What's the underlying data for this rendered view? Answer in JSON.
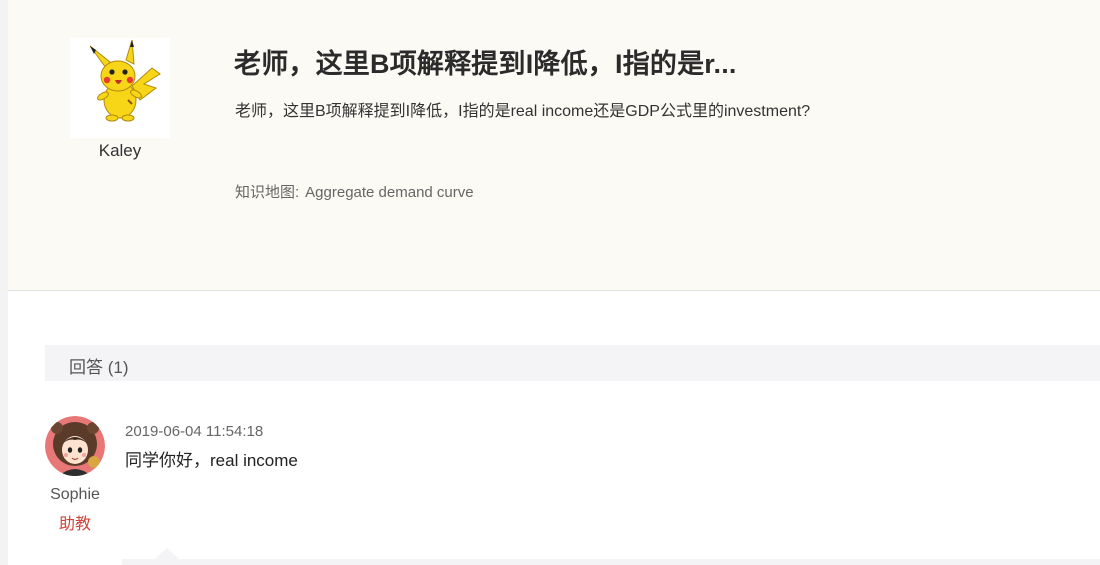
{
  "question": {
    "asker_name": "Kaley",
    "title": "老师，这里B项解释提到I降低，I指的是r...",
    "body": "老师，这里B项解释提到I降低，I指的是real income还是GDP公式里的investment?",
    "knowledge_map_label": "知识地图:",
    "knowledge_map_value": "Aggregate demand curve"
  },
  "answers": {
    "header": "回答 (1)",
    "items": [
      {
        "author_name": "Sophie",
        "author_role": "助教",
        "timestamp": "2019-06-04 11:54:18",
        "text": "同学你好，real income",
        "role_color": "#d0453b"
      }
    ]
  },
  "icons": {
    "asker_avatar": "pikachu-avatar-icon",
    "answerer_avatar": "cartoon-girl-avatar-icon"
  }
}
